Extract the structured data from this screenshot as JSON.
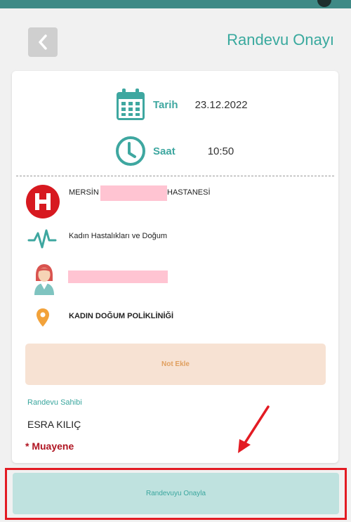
{
  "header": {
    "title": "Randevu Onayı"
  },
  "appointment": {
    "date_label": "Tarih",
    "date_value": "23.12.2022",
    "time_label": "Saat",
    "time_value": "10:50"
  },
  "details": {
    "hospital_prefix": "MERSİN",
    "hospital_suffix": "HASTANESİ",
    "department": "Kadın Hastalıkları ve Doğum",
    "clinic": "KADIN DOĞUM POLİKLİNİĞİ"
  },
  "note_button": "Not Ekle",
  "owner": {
    "label": "Randevu Sahibi",
    "name": "ESRA KILIÇ"
  },
  "appointment_type": "* Muayene",
  "confirm_button": "Randevuyu Onayla",
  "colors": {
    "teal": "#3ea7a0",
    "highlight_red": "#e31b23",
    "hospital_red": "#d71920",
    "pin_orange": "#f2a23a"
  }
}
